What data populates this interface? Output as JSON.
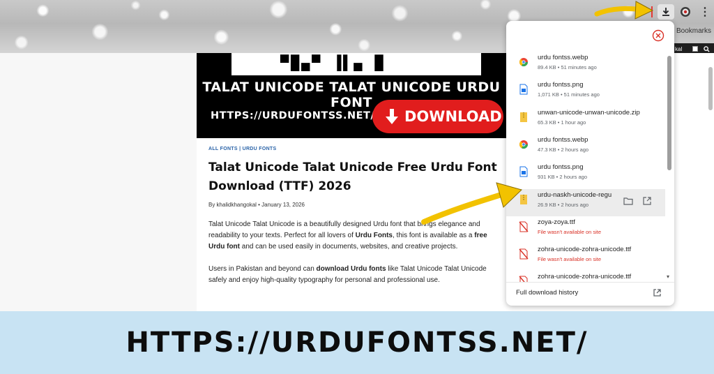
{
  "browser": {
    "bookmarks_label": "Bookmarks",
    "wp_user_label": "kal",
    "toolbar_icons": [
      "download-icon",
      "extension-icon",
      "kebab-menu-icon"
    ],
    "menu_glyph": "⋮"
  },
  "hero": {
    "title": "TALAT UNICODE TALAT UNICODE URDU FONT",
    "url": "HTTPS://URDUFONTSS.NET/",
    "download_label": "DOWNLOAD",
    "brand_color": "#e11d1d"
  },
  "article": {
    "categories": "ALL FONTS | URDU FONTS",
    "title": "Talat Unicode Talat Unicode Free Urdu Font Download (TTF) 2026",
    "byline": "By khalidkhangokal  •  January 13, 2026",
    "p1": {
      "a": "Talat Unicode Talat Unicode is a beautifully designed Urdu font that brings elegance and readability to your texts. Perfect for all lovers of ",
      "b": "Urdu Fonts",
      "c": ", this font is available as a ",
      "d": "free Urdu font",
      "e": " and can be used easily in documents, websites, and creative projects."
    },
    "p2": {
      "a": "Users in Pakistan and beyond can ",
      "b": "download Urdu fonts",
      "c": " like Talat Unicode Talat Unicode safely and enjoy high-quality typography for personal and professional use."
    }
  },
  "downloads": {
    "items": [
      {
        "name": "urdu fontss.webp",
        "meta": "89.4 KB • 51 minutes ago",
        "icon": "chrome-file-icon",
        "error": false
      },
      {
        "name": "urdu fontss.png",
        "meta": "1,071 KB • 51 minutes ago",
        "icon": "image-file-icon",
        "error": false
      },
      {
        "name": "unwan-unicode-unwan-unicode.zip",
        "meta": "65.3 KB • 1 hour ago",
        "icon": "zip-file-icon",
        "error": false
      },
      {
        "name": "urdu fontss.webp",
        "meta": "47.3 KB • 2 hours ago",
        "icon": "chrome-file-icon",
        "error": false
      },
      {
        "name": "urdu fontss.png",
        "meta": "931 KB • 2 hours ago",
        "icon": "image-file-icon",
        "error": false
      },
      {
        "name": "urdu-naskh-unicode-regu",
        "meta": "26.9 KB • 2 hours ago",
        "icon": "zip-file-icon",
        "error": false
      },
      {
        "name": "zoya-zoya.ttf",
        "meta": "File wasn't available on site",
        "icon": "failed-file-icon",
        "error": true
      },
      {
        "name": "zohra-unicode-zohra-unicode.ttf",
        "meta": "File wasn't available on site",
        "icon": "failed-file-icon",
        "error": true
      },
      {
        "name": "zohra-unicode-zohra-unicode.ttf",
        "meta": "",
        "icon": "failed-file-icon",
        "error": true
      }
    ],
    "footer_label": "Full download history",
    "error_color": "#d93025"
  },
  "banner": {
    "text": "HTTPS://URDUFONTSS.NET/"
  }
}
